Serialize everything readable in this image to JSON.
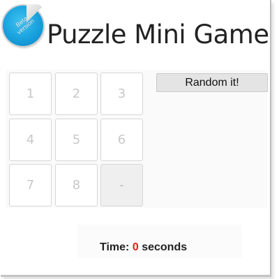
{
  "header": {
    "badge_text": "Beta version",
    "title": "Puzzle Mini Game"
  },
  "board": {
    "tiles": [
      "1",
      "2",
      "3",
      "4",
      "5",
      "6",
      "7",
      "8",
      "-"
    ]
  },
  "controls": {
    "random_label": "Random it!"
  },
  "timer": {
    "label": "Time:",
    "value": "0",
    "unit": "seconds"
  },
  "colors": {
    "badge": "#18a0dd",
    "timer_value": "#e0201a",
    "empty_tile": "#efefef"
  }
}
